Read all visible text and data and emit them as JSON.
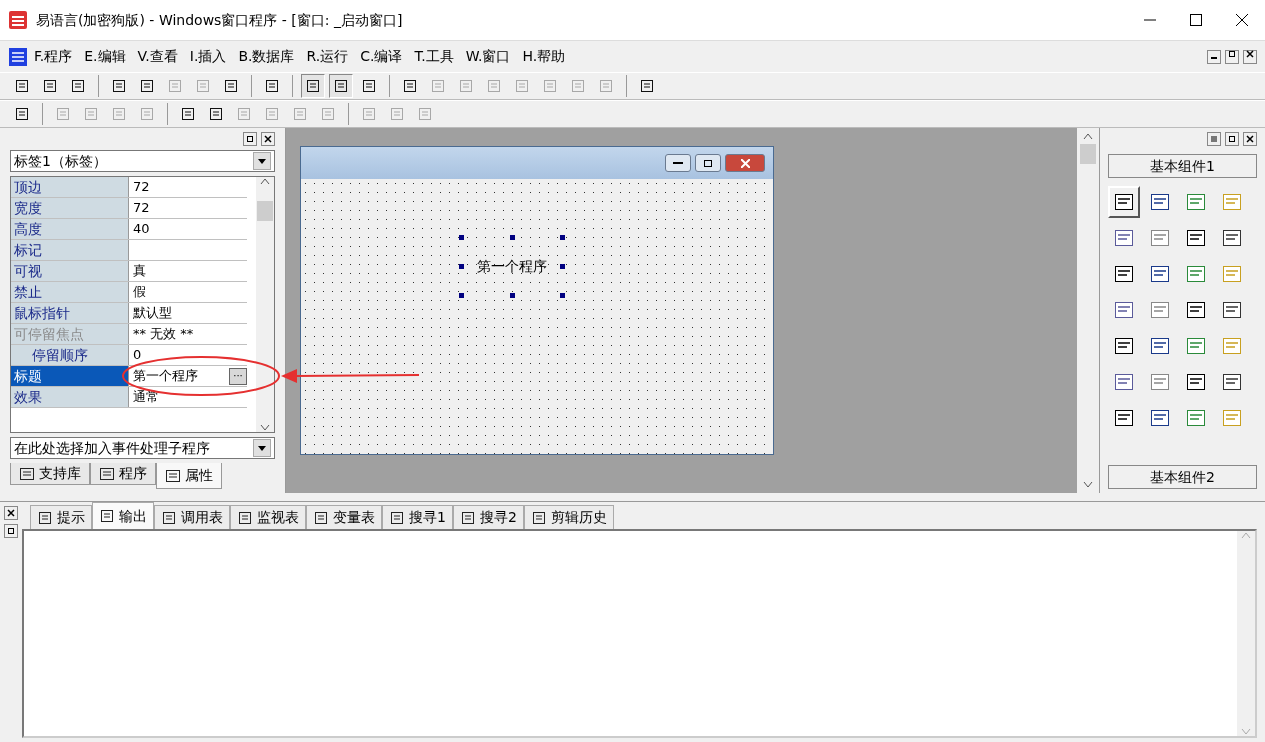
{
  "window": {
    "title": "易语言(加密狗版) - Windows窗口程序 - [窗口: _启动窗口]"
  },
  "menu": [
    "F.程序",
    "E.编辑",
    "V.查看",
    "I.插入",
    "B.数据库",
    "R.运行",
    "C.编译",
    "T.工具",
    "W.窗口",
    "H.帮助"
  ],
  "toolbar_1": [
    {
      "kind": "tool",
      "disabled": false,
      "pressed": false
    },
    {
      "kind": "tool",
      "disabled": false,
      "pressed": false
    },
    {
      "kind": "tool",
      "disabled": false,
      "pressed": false
    },
    {
      "kind": "separator"
    },
    {
      "kind": "tool",
      "disabled": false,
      "pressed": false
    },
    {
      "kind": "tool",
      "disabled": false,
      "pressed": false
    },
    {
      "kind": "tool",
      "disabled": true,
      "pressed": false
    },
    {
      "kind": "tool",
      "disabled": true,
      "pressed": false
    },
    {
      "kind": "tool",
      "disabled": false,
      "pressed": false
    },
    {
      "kind": "separator"
    },
    {
      "kind": "tool",
      "disabled": false,
      "pressed": false
    },
    {
      "kind": "separator"
    },
    {
      "kind": "tool",
      "disabled": false,
      "pressed": true
    },
    {
      "kind": "tool",
      "disabled": false,
      "pressed": true
    },
    {
      "kind": "tool",
      "disabled": false,
      "pressed": false
    },
    {
      "kind": "separator"
    },
    {
      "kind": "tool",
      "disabled": false,
      "pressed": false
    },
    {
      "kind": "tool",
      "disabled": true,
      "pressed": false
    },
    {
      "kind": "tool",
      "disabled": true,
      "pressed": false
    },
    {
      "kind": "tool",
      "disabled": true,
      "pressed": false
    },
    {
      "kind": "tool",
      "disabled": true,
      "pressed": false
    },
    {
      "kind": "tool",
      "disabled": true,
      "pressed": false
    },
    {
      "kind": "tool",
      "disabled": true,
      "pressed": false
    },
    {
      "kind": "tool",
      "disabled": true,
      "pressed": false
    },
    {
      "kind": "separator"
    },
    {
      "kind": "tool",
      "disabled": false,
      "pressed": false
    }
  ],
  "toolbar_2": [
    {
      "kind": "tool",
      "disabled": false,
      "pressed": false
    },
    {
      "kind": "separator"
    },
    {
      "kind": "tool",
      "disabled": true,
      "pressed": false
    },
    {
      "kind": "tool",
      "disabled": true,
      "pressed": false
    },
    {
      "kind": "tool",
      "disabled": true,
      "pressed": false
    },
    {
      "kind": "tool",
      "disabled": true,
      "pressed": false
    },
    {
      "kind": "separator"
    },
    {
      "kind": "tool",
      "disabled": false,
      "pressed": false
    },
    {
      "kind": "tool",
      "disabled": false,
      "pressed": false
    },
    {
      "kind": "tool",
      "disabled": true,
      "pressed": false
    },
    {
      "kind": "tool",
      "disabled": true,
      "pressed": false
    },
    {
      "kind": "tool",
      "disabled": true,
      "pressed": false
    },
    {
      "kind": "tool",
      "disabled": true,
      "pressed": false
    },
    {
      "kind": "separator"
    },
    {
      "kind": "tool",
      "disabled": true,
      "pressed": false
    },
    {
      "kind": "tool",
      "disabled": true,
      "pressed": false
    },
    {
      "kind": "tool",
      "disabled": true,
      "pressed": false
    }
  ],
  "properties": {
    "object_select": "标签1（标签）",
    "rows": [
      {
        "name": "顶边",
        "value": "72",
        "selected": false,
        "disabled": false
      },
      {
        "name": "宽度",
        "value": "72",
        "selected": false,
        "disabled": false
      },
      {
        "name": "高度",
        "value": "40",
        "selected": false,
        "disabled": false
      },
      {
        "name": "标记",
        "value": "",
        "selected": false,
        "disabled": false
      },
      {
        "name": "可视",
        "value": "真",
        "selected": false,
        "disabled": false
      },
      {
        "name": "禁止",
        "value": "假",
        "selected": false,
        "disabled": false
      },
      {
        "name": "鼠标指针",
        "value": "默认型",
        "selected": false,
        "disabled": false
      },
      {
        "name": "可停留焦点",
        "value": "** 无效 **",
        "selected": false,
        "disabled": true,
        "children": [
          {
            "name": "停留顺序",
            "value": "0",
            "selected": false,
            "disabled": false
          }
        ]
      },
      {
        "name": "标题",
        "value": "第一个程序",
        "selected": true,
        "disabled": false,
        "button": "···"
      },
      {
        "name": "效果",
        "value": "通常",
        "selected": false,
        "disabled": false
      }
    ],
    "event_select": "在此处选择加入事件处理子程序",
    "tabs": [
      {
        "label": "支持库",
        "selected": false
      },
      {
        "label": "程序",
        "selected": false
      },
      {
        "label": "属性",
        "selected": true
      }
    ]
  },
  "designer": {
    "label_text": "第一个程序"
  },
  "components": {
    "group_1": "基本组件1",
    "group_2": "基本组件2",
    "items": [
      {
        "selected": true
      },
      {
        "selected": false
      },
      {
        "selected": false
      },
      {
        "selected": false
      },
      {
        "selected": false
      },
      {
        "selected": false
      },
      {
        "selected": false
      },
      {
        "selected": false
      },
      {
        "selected": false
      },
      {
        "selected": false
      },
      {
        "selected": false
      },
      {
        "selected": false
      },
      {
        "selected": false
      },
      {
        "selected": false
      },
      {
        "selected": false
      },
      {
        "selected": false
      },
      {
        "selected": false
      },
      {
        "selected": false
      },
      {
        "selected": false
      },
      {
        "selected": false
      },
      {
        "selected": false
      },
      {
        "selected": false
      },
      {
        "selected": false
      },
      {
        "selected": false
      },
      {
        "selected": false
      },
      {
        "selected": false
      },
      {
        "selected": false
      },
      {
        "selected": false
      }
    ]
  },
  "bottom_tabs": [
    {
      "label": "提示",
      "selected": false
    },
    {
      "label": "输出",
      "selected": true
    },
    {
      "label": "调用表",
      "selected": false
    },
    {
      "label": "监视表",
      "selected": false
    },
    {
      "label": "变量表",
      "selected": false
    },
    {
      "label": "搜寻1",
      "selected": false
    },
    {
      "label": "搜寻2",
      "selected": false
    },
    {
      "label": "剪辑历史",
      "selected": false
    }
  ]
}
